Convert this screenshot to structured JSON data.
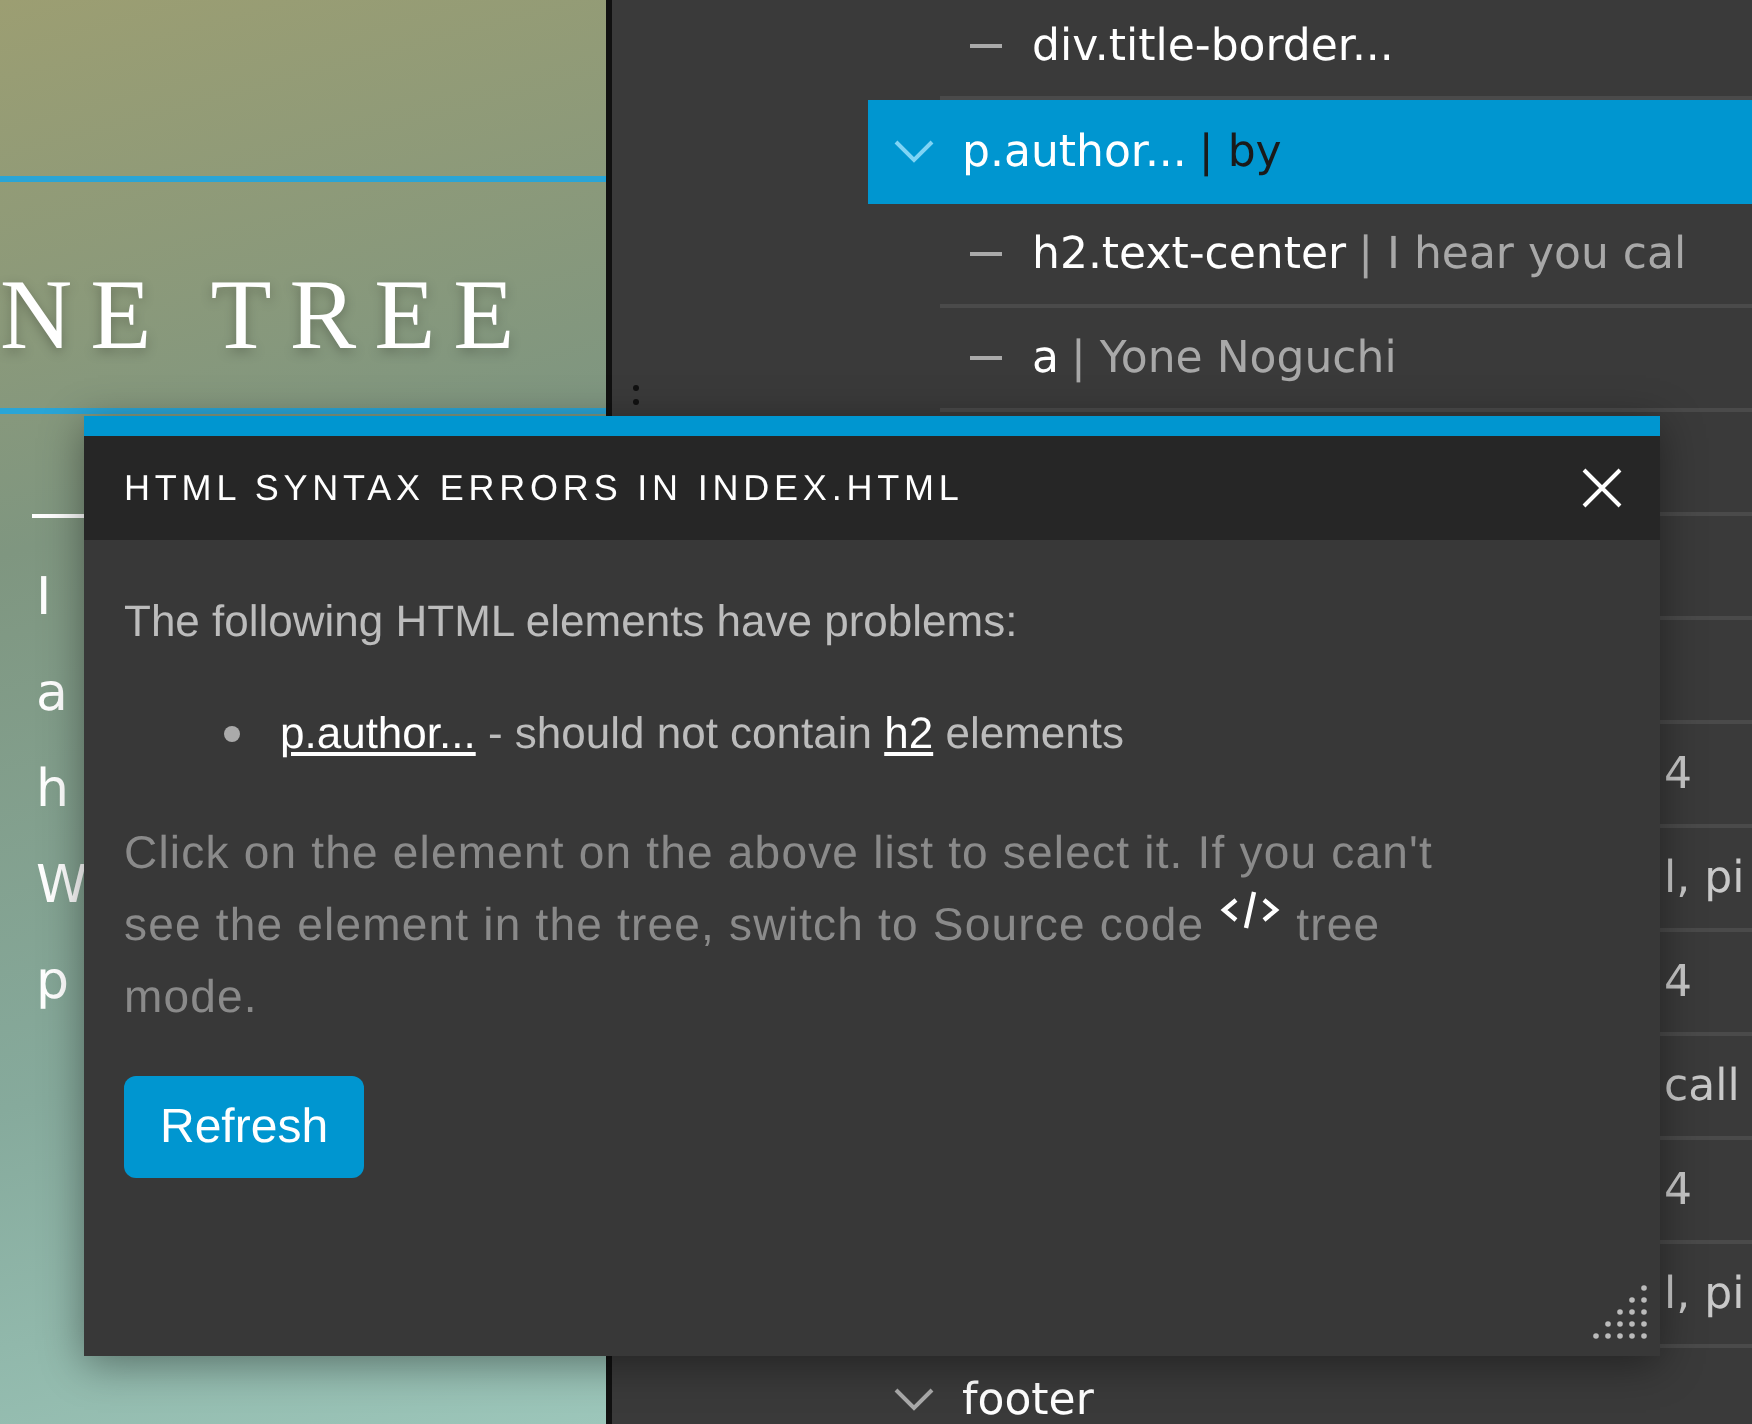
{
  "preview": {
    "title": "NE TREE",
    "lines": [
      "I",
      "a",
      "h",
      "W",
      "p"
    ]
  },
  "tree": {
    "rows": [
      {
        "kind": "leaf",
        "tag": "div.title-border...",
        "selected": false
      },
      {
        "kind": "branch",
        "tag": "p.author...",
        "content": "| by",
        "selected": true
      },
      {
        "kind": "leaf",
        "tag": "h2.text-center",
        "content": "| I hear you cal",
        "selected": false
      },
      {
        "kind": "leaf",
        "tag": "a",
        "content": "| Yone Noguchi",
        "selected": false
      },
      {
        "kind": "covered",
        "selected": false
      },
      {
        "kind": "covered",
        "selected": false
      },
      {
        "kind": "covered",
        "selected": false
      },
      {
        "kind": "fragment",
        "text": "4",
        "selected": false
      },
      {
        "kind": "fragment",
        "text": "l, pi",
        "selected": false
      },
      {
        "kind": "fragment",
        "text": "4",
        "selected": false
      },
      {
        "kind": "fragment",
        "text": "call",
        "selected": false
      },
      {
        "kind": "fragment",
        "text": "4",
        "selected": false
      },
      {
        "kind": "fragment",
        "text": "l, pi",
        "selected": false
      },
      {
        "kind": "branch",
        "tag": "footer",
        "selected": false
      }
    ]
  },
  "dialog": {
    "title": "HTML SYNTAX ERRORS IN INDEX.HTML",
    "intro": "The following HTML elements have problems:",
    "errors": [
      {
        "element": "p.author...",
        "before": " - should not contain ",
        "child": "h2",
        "after": " elements"
      }
    ],
    "hint_before": "Click on the element on the above list to select it. If you can't see the element in the tree, switch to Source code ",
    "hint_after": " tree mode.",
    "button": "Refresh"
  }
}
